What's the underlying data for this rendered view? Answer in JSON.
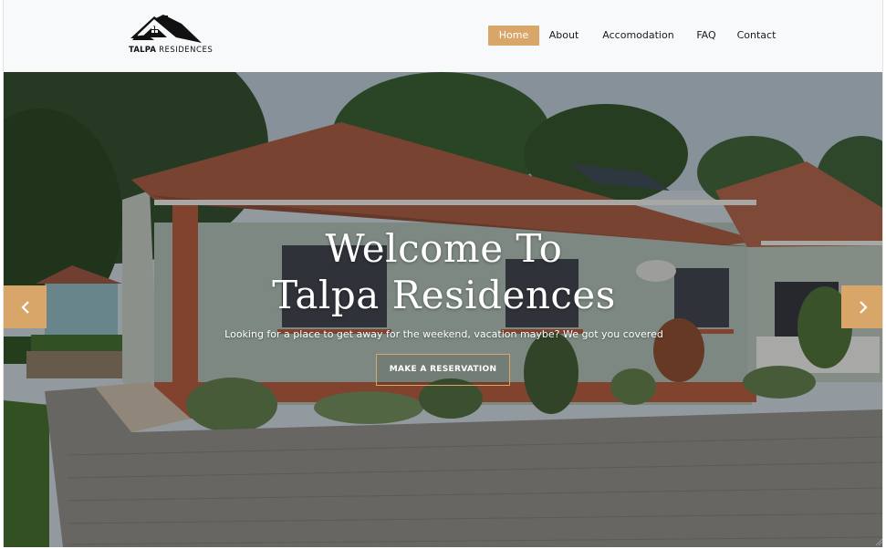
{
  "brand": {
    "name_bold": "TALPA",
    "name_light": "RESIDENCES"
  },
  "nav": {
    "items": [
      {
        "label": "Home",
        "active": true
      },
      {
        "label": "About",
        "active": false
      },
      {
        "label": "Accomodation",
        "active": false
      },
      {
        "label": "FAQ",
        "active": false
      },
      {
        "label": "Contact",
        "active": false
      }
    ]
  },
  "hero": {
    "title_line1": "Welcome To",
    "title_line2": "Talpa Residences",
    "subtitle": "Looking for a place to get away for the weekend, vacation maybe? We got you covered",
    "cta_label": "MAKE A RESERVATION",
    "prev_icon": "chevron-left-icon",
    "next_icon": "chevron-right-icon"
  },
  "colors": {
    "accent": "#d7a668",
    "header_bg": "#f8f9fb",
    "text_dark": "#1b1b1b",
    "roof": "#a45a3e",
    "wall": "#9fb2a6"
  }
}
